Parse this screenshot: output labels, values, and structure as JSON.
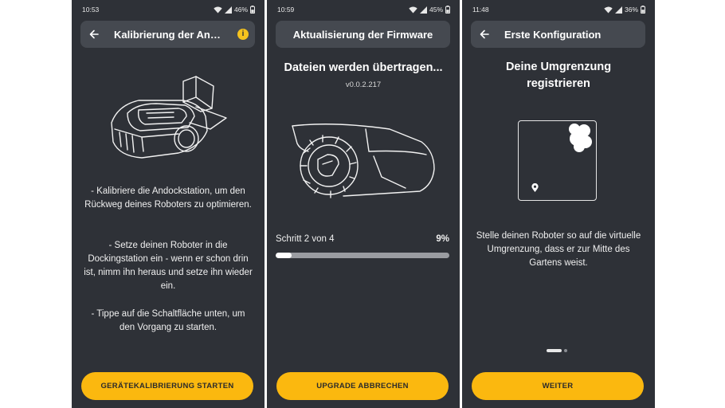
{
  "screens": [
    {
      "status": {
        "time": "10:53",
        "battery": "46%"
      },
      "header": {
        "title": "Kalibrierung der Andockstation",
        "icons": [
          "back-arrow-icon",
          "info-icon"
        ]
      },
      "illustration": "robot-mower-docking-station",
      "paragraphs": [
        "- Kalibriere die Andockstation, um den Rückweg deines Roboters zu optimieren.",
        "- Setze deinen Roboter in die Dockingstation ein - wenn er schon drin ist, nimm ihn heraus und setze ihn wieder ein.",
        "- Tippe auf die Schaltfläche unten, um den Vorgang zu starten."
      ],
      "button": "GERÄTEKALIBRIERUNG STARTEN"
    },
    {
      "status": {
        "time": "10:59",
        "battery": "45%"
      },
      "header": {
        "title": "Aktualisierung der Firmware"
      },
      "heading": "Dateien werden übertragen...",
      "version": "v0.0.2.217",
      "illustration": "robot-mower-side-view",
      "progress": {
        "label": "Schritt 2 von 4",
        "percent_text": "9%",
        "value": 0.09
      },
      "button": "UPGRADE ABBRECHEN"
    },
    {
      "status": {
        "time": "11:48",
        "battery": "36%"
      },
      "header": {
        "title": "Erste Konfiguration",
        "icons": [
          "back-arrow-icon"
        ]
      },
      "heading": "Deine Umgrenzung registrieren",
      "illustration": "boundary-map-with-location-pin",
      "description": "Stelle deinen Roboter so auf die virtuelle Umgrenzung, dass er zur Mitte des Gartens weist.",
      "pager": {
        "pages": 2,
        "active": 1
      },
      "button": "WEITER"
    }
  ],
  "colors": {
    "background": "#2e3137",
    "header": "#454950",
    "accent": "#fbb80f",
    "text": "#ffffff"
  }
}
